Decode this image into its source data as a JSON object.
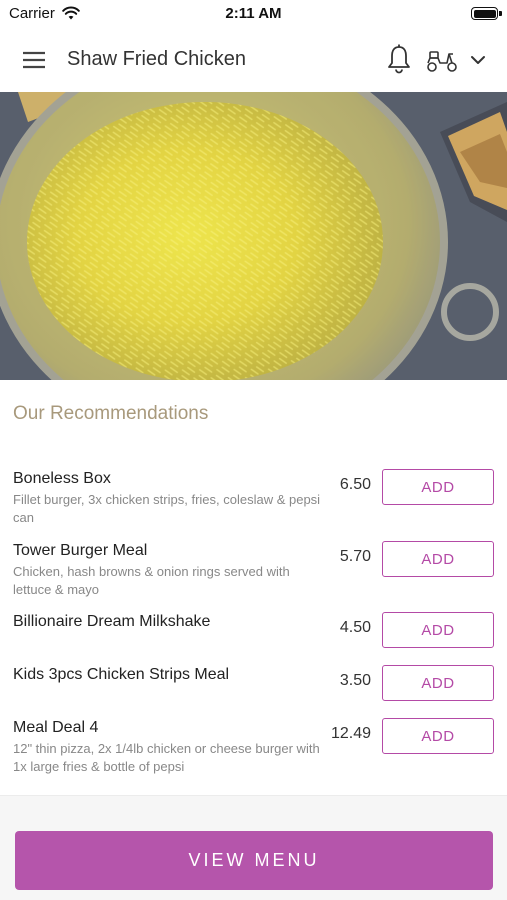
{
  "status_bar": {
    "carrier": "Carrier",
    "time": "2:11 AM"
  },
  "nav": {
    "title": "Shaw Fried Chicken",
    "icons": [
      "hamburger-menu-icon",
      "bell-icon",
      "scooter-icon",
      "chevron-down-icon"
    ]
  },
  "hero": {
    "image": "yellow rice in a pan"
  },
  "recommendations": {
    "title": "Our Recommendations",
    "items": [
      {
        "name": "Boneless Box",
        "description": "Fillet burger, 3x chicken strips, fries, coleslaw & pepsi can",
        "price": "6.50",
        "button": "ADD"
      },
      {
        "name": "Tower Burger Meal",
        "description": "Chicken, hash browns & onion rings served with lettuce & mayo",
        "price": "5.70",
        "button": "ADD"
      },
      {
        "name": "Billionaire Dream Milkshake",
        "description": "",
        "price": "4.50",
        "button": "ADD"
      },
      {
        "name": "Kids 3pcs Chicken Strips Meal",
        "description": "",
        "price": "3.50",
        "button": "ADD"
      },
      {
        "name": "Meal Deal 4",
        "description": "12\" thin pizza, 2x 1/4lb chicken or cheese burger with 1x large fries & bottle of pepsi",
        "price": "12.49",
        "button": "ADD"
      }
    ]
  },
  "footer": {
    "view_menu_label": "VIEW MENU"
  },
  "colors": {
    "accent": "#b44aa6",
    "section_title": "#a8997c",
    "view_menu_bg": "#b555ab"
  }
}
